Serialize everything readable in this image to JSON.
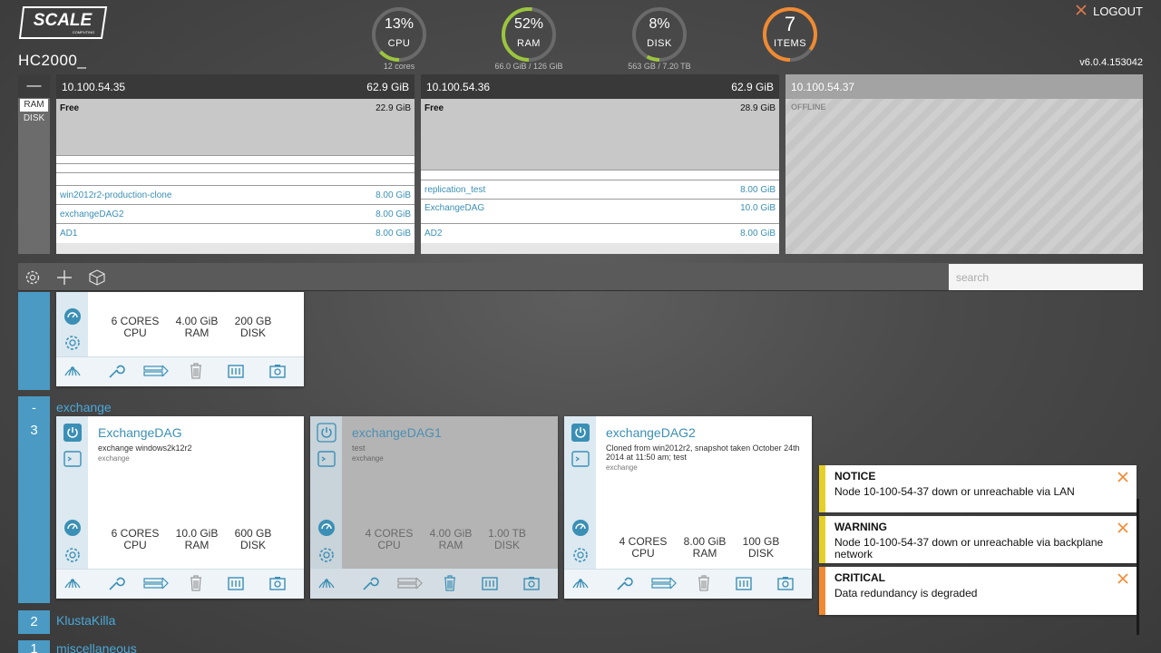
{
  "header": {
    "brand": "SCALE",
    "brand_sub": "COMPUTING",
    "cluster_name": "HC2000_",
    "version": "v6.0.4.153042",
    "logout_label": "LOGOUT",
    "gauges": [
      {
        "pct": "13%",
        "label": "CPU",
        "sub": "12 cores",
        "fraction": 0.13,
        "color": "#9bc53d"
      },
      {
        "pct": "52%",
        "label": "RAM",
        "sub": "66.0 GiB / 126 GiB",
        "fraction": 0.52,
        "color": "#9bc53d"
      },
      {
        "pct": "8%",
        "label": "DISK",
        "sub": "563 GB / 7.20 TB",
        "fraction": 0.08,
        "color": "#9bc53d"
      },
      {
        "pct": "7",
        "label": "ITEMS",
        "sub": "",
        "fraction": 0.85,
        "color": "#f08a32"
      }
    ]
  },
  "node_panel": {
    "toggle": "—",
    "ram_tab": "RAM",
    "disk_tab": "DISK",
    "nodes": [
      {
        "ip": "10.100.54.35",
        "total": "62.9 GiB",
        "free_label": "Free",
        "free_value": "22.9 GiB",
        "vms": [
          {
            "name": "win2012r2-production-clone",
            "size": "8.00 GiB"
          },
          {
            "name": "exchangeDAG2",
            "size": "8.00 GiB"
          },
          {
            "name": "AD1",
            "size": "8.00 GiB"
          }
        ]
      },
      {
        "ip": "10.100.54.36",
        "total": "62.9 GiB",
        "free_label": "Free",
        "free_value": "28.9 GiB",
        "vms": [
          {
            "name": "replication_test",
            "size": "8.00 GiB"
          },
          {
            "name": "ExchangeDAG",
            "size": "10.0 GiB"
          },
          {
            "name": "AD2",
            "size": "8.00 GiB"
          }
        ]
      },
      {
        "ip": "10.100.54.37",
        "status": "OFFLINE"
      }
    ]
  },
  "toolbar": {
    "settings_icon": "gear-icon",
    "add_icon": "plus-icon",
    "import_icon": "box-icon",
    "search_placeholder": "search"
  },
  "groups": {
    "top_card": {
      "cores": "6 CORES",
      "cpu": "CPU",
      "ram_val": "4.00 GiB",
      "ram": "RAM",
      "disk_val": "200 GB",
      "disk": "DISK"
    },
    "exchange": {
      "toggle": "-",
      "count": "3",
      "name": "exchange",
      "cards": [
        {
          "title": "ExchangeDAG",
          "desc": "exchange windows2k12r2",
          "tag": "exchange",
          "cores": "6 CORES",
          "ram_val": "10.0 GiB",
          "disk_val": "600 GB",
          "cpu": "CPU",
          "ram": "RAM",
          "disk": "DISK",
          "running": true
        },
        {
          "title": "exchangeDAG1",
          "desc": "test",
          "tag": "exchange",
          "cores": "4 CORES",
          "ram_val": "4.00 GiB",
          "disk_val": "1.00 TB",
          "cpu": "CPU",
          "ram": "RAM",
          "disk": "DISK",
          "running": false
        },
        {
          "title": "exchangeDAG2",
          "desc": "Cloned from win2012r2, snapshot taken October 24th 2014 at 11:50 am; test",
          "tag": "exchange",
          "cores": "4 CORES",
          "ram_val": "8.00 GiB",
          "disk_val": "100 GB",
          "cpu": "CPU",
          "ram": "RAM",
          "disk": "DISK",
          "running": true
        }
      ]
    },
    "klusta": {
      "count": "2",
      "name": "KlustaKilla"
    },
    "misc": {
      "count": "1",
      "name": "miscellaneous"
    }
  },
  "alerts": [
    {
      "level": "NOTICE",
      "message": "Node 10-100-54-37 down or unreachable via LAN",
      "color": "#e6d028"
    },
    {
      "level": "WARNING",
      "message": "Node 10-100-54-37 down or unreachable via backplane network",
      "color": "#e6d028"
    },
    {
      "level": "CRITICAL",
      "message": "Data redundancy is degraded",
      "color": "#f08a32"
    }
  ]
}
